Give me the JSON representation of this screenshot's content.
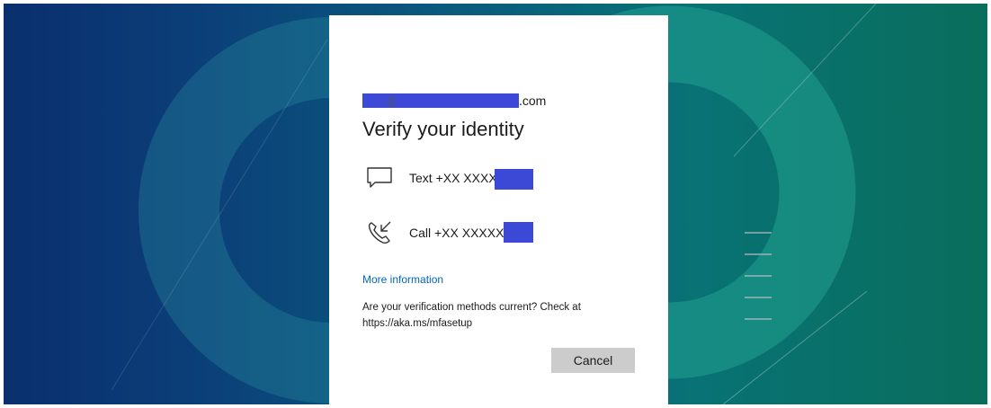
{
  "account": {
    "email_at": "@",
    "email_domain": ".com"
  },
  "title": "Verify your identity",
  "options": [
    {
      "label": "Text +XX XXXX",
      "icon": "message-icon"
    },
    {
      "label": "Call +XX XXXXX",
      "icon": "phone-call-icon"
    }
  ],
  "more_info": "More information",
  "check_message": "Are your verification methods current? Check at https://aka.ms/mfasetup",
  "cancel_label": "Cancel",
  "colors": {
    "link": "#0067b8",
    "redaction": "#3b49d6",
    "button": "#cccccc"
  }
}
